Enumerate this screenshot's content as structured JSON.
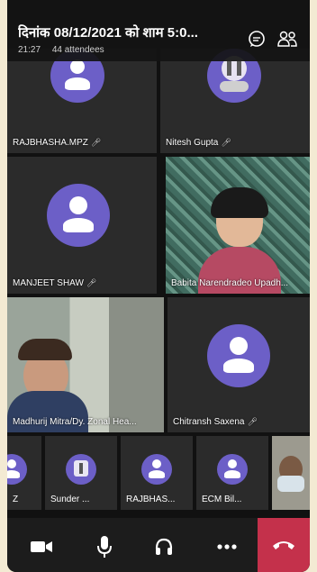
{
  "meeting": {
    "title": "दिनांक 08/12/2021 को शाम 5:0...",
    "time": "21:27",
    "attendees": "44 attendees"
  },
  "participants": [
    {
      "name": "RAJBHASHA.MPZ",
      "type": "avatar"
    },
    {
      "name": "Nitesh  Gupta",
      "type": "avatar-photo"
    },
    {
      "name": "MANJEET  SHAW",
      "type": "avatar"
    },
    {
      "name": "Babita Narendradeo Upadh...",
      "type": "video"
    },
    {
      "name": "Madhurij Mitra/Dy. Zonal Hea...",
      "type": "video"
    },
    {
      "name": "Chitransh  Saxena",
      "type": "avatar"
    }
  ],
  "strip": [
    {
      "name": "Z"
    },
    {
      "name": "Sunder ..."
    },
    {
      "name": "RAJBHAS..."
    },
    {
      "name": "ECM Bil..."
    },
    {
      "name": ""
    }
  ],
  "colors": {
    "avatar": "#6c5fc7",
    "hangup": "#c4314b"
  },
  "icons": {
    "mic_indicator": "mic-icon",
    "chat": "chat-icon",
    "people": "people-icon",
    "camera": "camera-icon",
    "mic": "mic-icon",
    "audio": "headset-icon",
    "more": "more-icon",
    "hangup": "hangup-icon"
  }
}
